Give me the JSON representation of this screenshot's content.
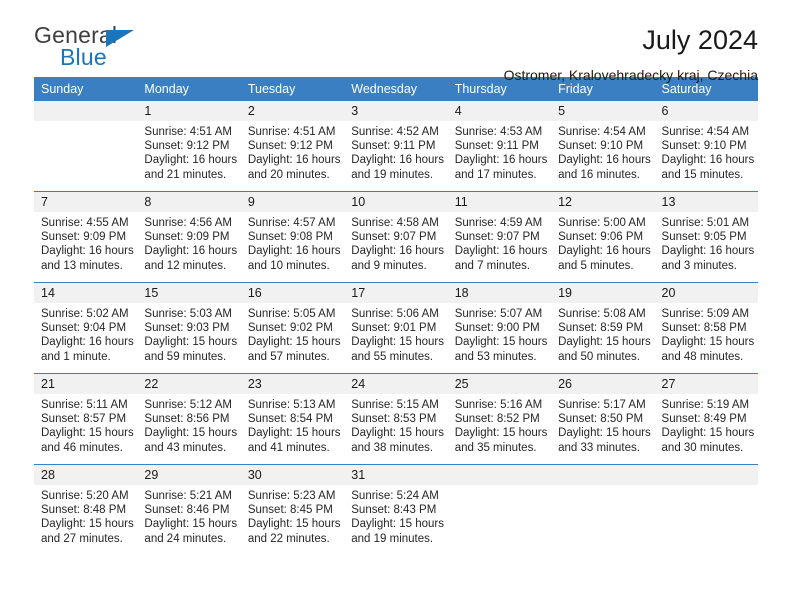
{
  "brand": {
    "name_part1": "General",
    "name_part2": "Blue"
  },
  "header": {
    "title": "July 2024",
    "subtitle": "Ostromer, Kralovehradecky kraj, Czechia"
  },
  "colors": {
    "header_blue": "#3a7fc1",
    "brand_blue": "#1b75bc",
    "daynum_band": "#f1f1f1",
    "text": "#1a1a1a"
  },
  "weekdays": [
    "Sunday",
    "Monday",
    "Tuesday",
    "Wednesday",
    "Thursday",
    "Friday",
    "Saturday"
  ],
  "weeks": [
    [
      {
        "day": "",
        "lines": []
      },
      {
        "day": "1",
        "lines": [
          "Sunrise: 4:51 AM",
          "Sunset: 9:12 PM",
          "Daylight: 16 hours",
          "and 21 minutes."
        ]
      },
      {
        "day": "2",
        "lines": [
          "Sunrise: 4:51 AM",
          "Sunset: 9:12 PM",
          "Daylight: 16 hours",
          "and 20 minutes."
        ]
      },
      {
        "day": "3",
        "lines": [
          "Sunrise: 4:52 AM",
          "Sunset: 9:11 PM",
          "Daylight: 16 hours",
          "and 19 minutes."
        ]
      },
      {
        "day": "4",
        "lines": [
          "Sunrise: 4:53 AM",
          "Sunset: 9:11 PM",
          "Daylight: 16 hours",
          "and 17 minutes."
        ]
      },
      {
        "day": "5",
        "lines": [
          "Sunrise: 4:54 AM",
          "Sunset: 9:10 PM",
          "Daylight: 16 hours",
          "and 16 minutes."
        ]
      },
      {
        "day": "6",
        "lines": [
          "Sunrise: 4:54 AM",
          "Sunset: 9:10 PM",
          "Daylight: 16 hours",
          "and 15 minutes."
        ]
      }
    ],
    [
      {
        "day": "7",
        "lines": [
          "Sunrise: 4:55 AM",
          "Sunset: 9:09 PM",
          "Daylight: 16 hours",
          "and 13 minutes."
        ]
      },
      {
        "day": "8",
        "lines": [
          "Sunrise: 4:56 AM",
          "Sunset: 9:09 PM",
          "Daylight: 16 hours",
          "and 12 minutes."
        ]
      },
      {
        "day": "9",
        "lines": [
          "Sunrise: 4:57 AM",
          "Sunset: 9:08 PM",
          "Daylight: 16 hours",
          "and 10 minutes."
        ]
      },
      {
        "day": "10",
        "lines": [
          "Sunrise: 4:58 AM",
          "Sunset: 9:07 PM",
          "Daylight: 16 hours",
          "and 9 minutes."
        ]
      },
      {
        "day": "11",
        "lines": [
          "Sunrise: 4:59 AM",
          "Sunset: 9:07 PM",
          "Daylight: 16 hours",
          "and 7 minutes."
        ]
      },
      {
        "day": "12",
        "lines": [
          "Sunrise: 5:00 AM",
          "Sunset: 9:06 PM",
          "Daylight: 16 hours",
          "and 5 minutes."
        ]
      },
      {
        "day": "13",
        "lines": [
          "Sunrise: 5:01 AM",
          "Sunset: 9:05 PM",
          "Daylight: 16 hours",
          "and 3 minutes."
        ]
      }
    ],
    [
      {
        "day": "14",
        "lines": [
          "Sunrise: 5:02 AM",
          "Sunset: 9:04 PM",
          "Daylight: 16 hours",
          "and 1 minute."
        ]
      },
      {
        "day": "15",
        "lines": [
          "Sunrise: 5:03 AM",
          "Sunset: 9:03 PM",
          "Daylight: 15 hours",
          "and 59 minutes."
        ]
      },
      {
        "day": "16",
        "lines": [
          "Sunrise: 5:05 AM",
          "Sunset: 9:02 PM",
          "Daylight: 15 hours",
          "and 57 minutes."
        ]
      },
      {
        "day": "17",
        "lines": [
          "Sunrise: 5:06 AM",
          "Sunset: 9:01 PM",
          "Daylight: 15 hours",
          "and 55 minutes."
        ]
      },
      {
        "day": "18",
        "lines": [
          "Sunrise: 5:07 AM",
          "Sunset: 9:00 PM",
          "Daylight: 15 hours",
          "and 53 minutes."
        ]
      },
      {
        "day": "19",
        "lines": [
          "Sunrise: 5:08 AM",
          "Sunset: 8:59 PM",
          "Daylight: 15 hours",
          "and 50 minutes."
        ]
      },
      {
        "day": "20",
        "lines": [
          "Sunrise: 5:09 AM",
          "Sunset: 8:58 PM",
          "Daylight: 15 hours",
          "and 48 minutes."
        ]
      }
    ],
    [
      {
        "day": "21",
        "lines": [
          "Sunrise: 5:11 AM",
          "Sunset: 8:57 PM",
          "Daylight: 15 hours",
          "and 46 minutes."
        ]
      },
      {
        "day": "22",
        "lines": [
          "Sunrise: 5:12 AM",
          "Sunset: 8:56 PM",
          "Daylight: 15 hours",
          "and 43 minutes."
        ]
      },
      {
        "day": "23",
        "lines": [
          "Sunrise: 5:13 AM",
          "Sunset: 8:54 PM",
          "Daylight: 15 hours",
          "and 41 minutes."
        ]
      },
      {
        "day": "24",
        "lines": [
          "Sunrise: 5:15 AM",
          "Sunset: 8:53 PM",
          "Daylight: 15 hours",
          "and 38 minutes."
        ]
      },
      {
        "day": "25",
        "lines": [
          "Sunrise: 5:16 AM",
          "Sunset: 8:52 PM",
          "Daylight: 15 hours",
          "and 35 minutes."
        ]
      },
      {
        "day": "26",
        "lines": [
          "Sunrise: 5:17 AM",
          "Sunset: 8:50 PM",
          "Daylight: 15 hours",
          "and 33 minutes."
        ]
      },
      {
        "day": "27",
        "lines": [
          "Sunrise: 5:19 AM",
          "Sunset: 8:49 PM",
          "Daylight: 15 hours",
          "and 30 minutes."
        ]
      }
    ],
    [
      {
        "day": "28",
        "lines": [
          "Sunrise: 5:20 AM",
          "Sunset: 8:48 PM",
          "Daylight: 15 hours",
          "and 27 minutes."
        ]
      },
      {
        "day": "29",
        "lines": [
          "Sunrise: 5:21 AM",
          "Sunset: 8:46 PM",
          "Daylight: 15 hours",
          "and 24 minutes."
        ]
      },
      {
        "day": "30",
        "lines": [
          "Sunrise: 5:23 AM",
          "Sunset: 8:45 PM",
          "Daylight: 15 hours",
          "and 22 minutes."
        ]
      },
      {
        "day": "31",
        "lines": [
          "Sunrise: 5:24 AM",
          "Sunset: 8:43 PM",
          "Daylight: 15 hours",
          "and 19 minutes."
        ]
      },
      {
        "day": "",
        "lines": []
      },
      {
        "day": "",
        "lines": []
      },
      {
        "day": "",
        "lines": []
      }
    ]
  ]
}
